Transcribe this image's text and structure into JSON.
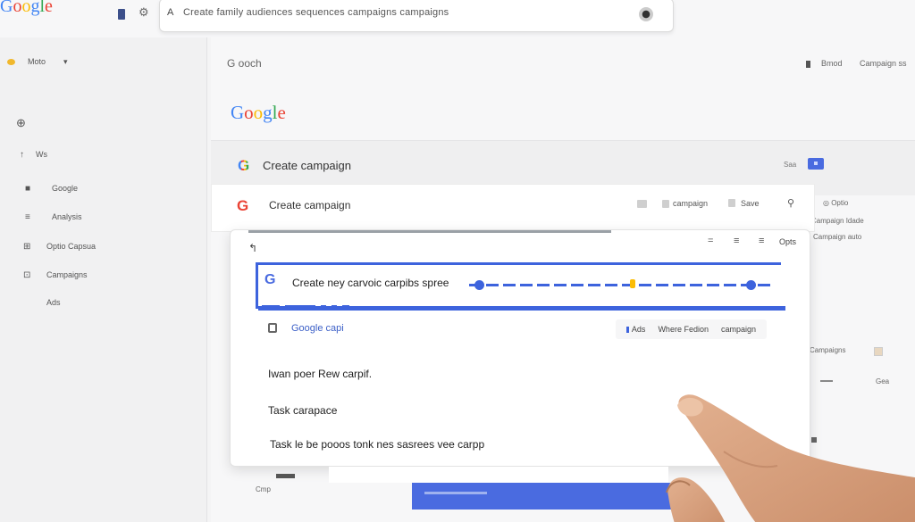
{
  "topbar": {
    "logo": "Google",
    "search_text": "Create family audiences sequences campaigns campaigns"
  },
  "sidebar": {
    "items": [
      {
        "icon": "yellow-dot",
        "label": "Moto"
      },
      {
        "icon": "globe-icon",
        "label": ""
      },
      {
        "icon": "caret",
        "label": "Ws"
      },
      {
        "icon": "square-icon",
        "label": "Google"
      },
      {
        "icon": "list-icon",
        "label": "Analysis"
      },
      {
        "icon": "grid-icon",
        "label": "Optio Capsua"
      },
      {
        "icon": "doc-icon",
        "label": "Campaigns"
      },
      {
        "icon": "",
        "label": "Ads"
      }
    ]
  },
  "main": {
    "breadcrumb": "G ooch",
    "top_right": [
      "Bmod",
      "Campaign ss"
    ],
    "logo": "Google",
    "card_title": "Create campaign",
    "save_label": "Saa"
  },
  "card2": {
    "title": "Create campaign",
    "actions": [
      "campaign",
      "Save"
    ]
  },
  "right_ghost": [
    "Optio",
    "Campaign Idade",
    "Campaign auto",
    "Campaigns",
    "Gea"
  ],
  "dialog": {
    "back": "↰",
    "options": "Opts",
    "prompt_text": "Create ney carvoic carpibs spree",
    "brand_label": "Google capi",
    "tool_buttons": [
      "Ads",
      "Where Fedion",
      "campaign"
    ],
    "lines": [
      "Iwan poer Rew carpif.",
      "Task carapace",
      "Task le be pooos tonk nes sasrees vee carpp"
    ]
  },
  "bottom": {
    "small_label": "Cmp"
  }
}
